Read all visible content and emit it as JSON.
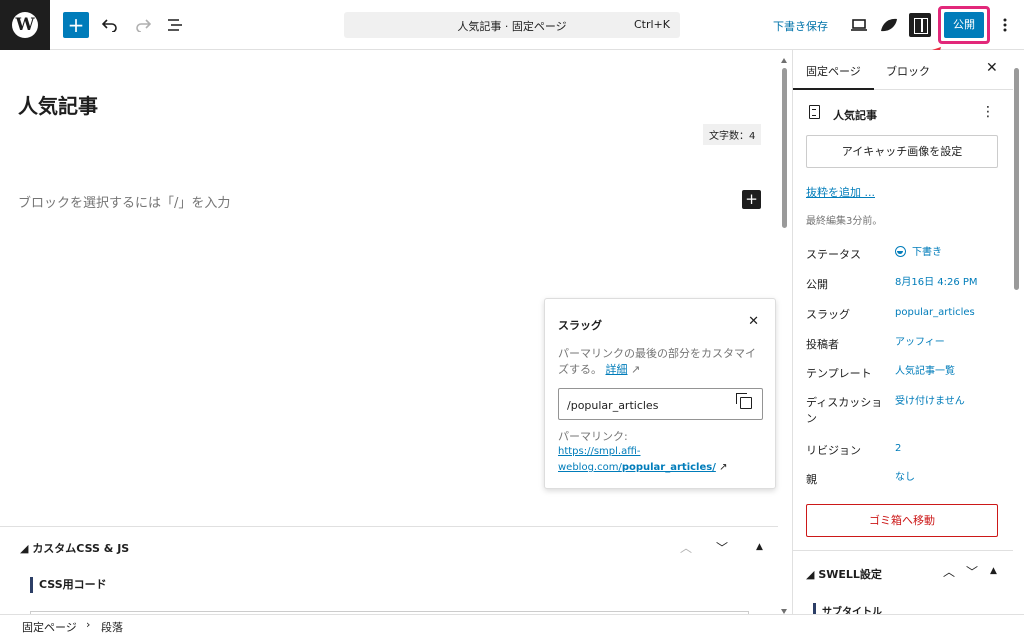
{
  "toolbar": {
    "command_title": "人気記事 · 固定ページ",
    "command_shortcut": "Ctrl+K",
    "save_draft": "下書き保存",
    "publish": "公開"
  },
  "editor": {
    "title": "人気記事",
    "word_count": "文字数：4",
    "block_placeholder": "ブロックを選択するには「/」を入力"
  },
  "slug_popover": {
    "heading": "スラッグ",
    "description": "パーマリンクの最後の部分をカスタマイズする。",
    "details_link": "詳細",
    "slug_value": "/popular_articles",
    "permalink_label": "パーマリンク:",
    "permalink_url_prefix": "https://smpl.affi-weblog.com/",
    "permalink_url_slug": "popular_articles/"
  },
  "custom_css": {
    "heading": "カスタムCSS & JS",
    "css_label": "CSS用コード"
  },
  "sidebar": {
    "tabs": [
      "固定ページ",
      "ブロック"
    ],
    "page_name": "人気記事",
    "featured_image_button": "アイキャッチ画像を設定",
    "excerpt_link": "抜粋を追加 ...",
    "last_edited": "最終編集3分前。",
    "properties": [
      {
        "label": "ステータス",
        "value": "下書き"
      },
      {
        "label": "公開",
        "value": "8月16日 4:26 PM"
      },
      {
        "label": "スラッグ",
        "value": "popular_articles"
      },
      {
        "label": "投稿者",
        "value": "アッフィー"
      },
      {
        "label": "テンプレート",
        "value": "人気記事一覧"
      },
      {
        "label": "ディスカッション",
        "value": "受け付けません"
      },
      {
        "label": "リビジョン",
        "value": "2"
      },
      {
        "label": "親",
        "value": "なし"
      }
    ],
    "trash_button": "ゴミ箱へ移動",
    "swell_heading": "SWELL設定",
    "swell_sub": "サブタイトル"
  },
  "breadcrumb": {
    "items": [
      "固定ページ",
      "段落"
    ]
  }
}
